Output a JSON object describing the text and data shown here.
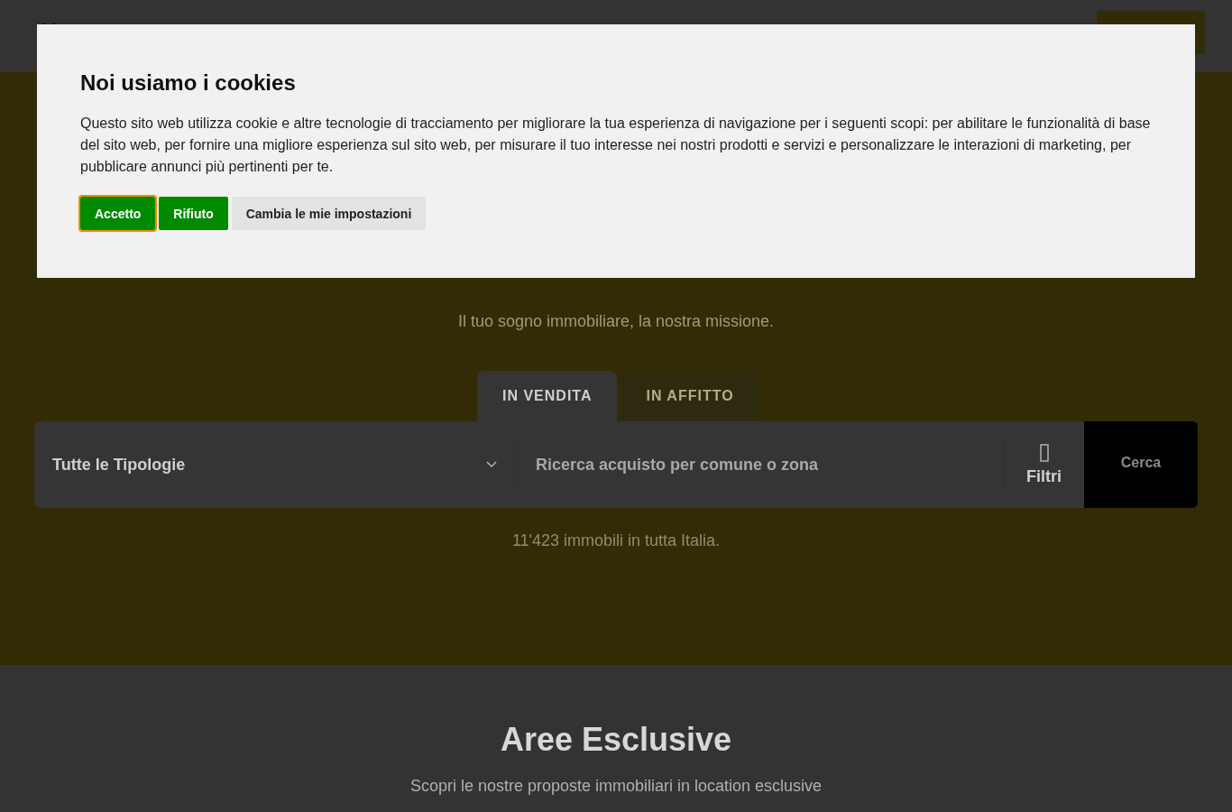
{
  "cookie_dialog": {
    "title": "Noi usiamo i cookies",
    "text": "Questo sito web utilizza cookie e altre tecnologie di tracciamento per migliorare la tua esperienza di navigazione per i seguenti scopi: per abilitare le funzionalità di base del sito web, per fornire una migliore esperienza sul sito web, per misurare il tuo interesse nei nostri prodotti e servizi e personalizzare le interazioni di marketing, per pubblicare annunci più pertinenti per te.",
    "buttons": [
      {
        "label": "Accetto",
        "kind": "primary",
        "focused": true
      },
      {
        "label": "Rifiuto",
        "kind": "primary",
        "focused": false
      },
      {
        "label": "Cambia le mie impostazioni",
        "kind": "secondary",
        "focused": false
      }
    ]
  },
  "hero": {
    "tagline": "Il tuo sogno immobiliare, la nostra missione.",
    "tabs": [
      {
        "label": "IN VENDITA",
        "selected": true
      },
      {
        "label": "IN AFFITTO",
        "selected": false
      }
    ],
    "search": {
      "type_select": {
        "value": "Tutte le Tipologie"
      },
      "location": {
        "placeholder": "Ricerca acquisto per comune o zona"
      },
      "filters_label": "Filtri",
      "search_label": "Cerca"
    },
    "count": "11'423 immobili in tutta Italia."
  },
  "section": {
    "title": "Aree Esclusive",
    "subtitle": "Scopri le nostre proposte immobiliari in location esclusive"
  }
}
